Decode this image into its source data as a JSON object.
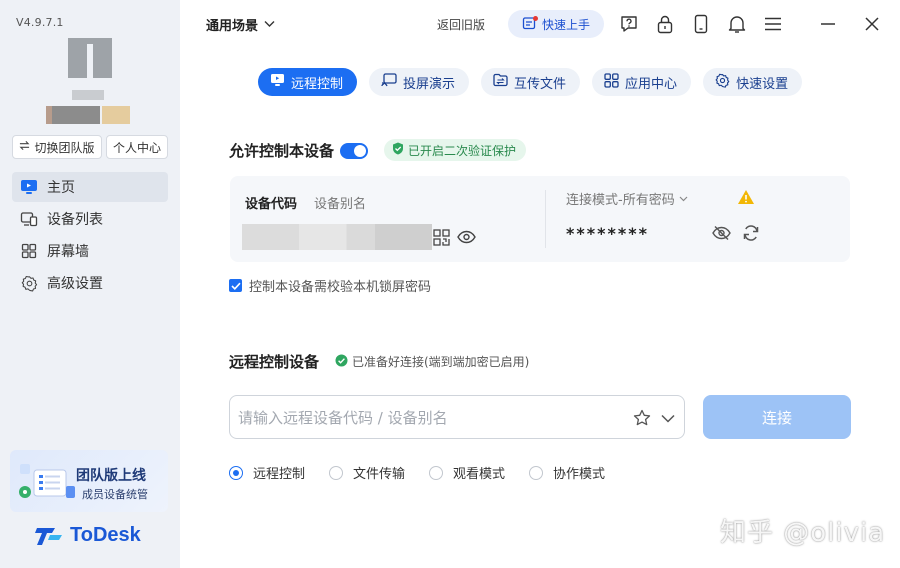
{
  "app": {
    "version": "V4.9.7.1",
    "brand_name": "ToDesk"
  },
  "sidebar": {
    "switch_team_label": "切换团队版",
    "personal_center_label": "个人中心",
    "items": [
      {
        "label": "主页",
        "icon": "monitor-icon",
        "active": true
      },
      {
        "label": "设备列表",
        "icon": "devices-icon",
        "active": false
      },
      {
        "label": "屏幕墙",
        "icon": "grid-icon",
        "active": false
      },
      {
        "label": "高级设置",
        "icon": "gear-icon",
        "active": false
      }
    ],
    "promo": {
      "title": "团队版上线",
      "subtitle": "成员设备统管"
    }
  },
  "topbar": {
    "scene_label": "通用场景",
    "back_old_label": "返回旧版",
    "quick_start_label": "快速上手",
    "icons": [
      "help-icon",
      "lock-icon",
      "phone-icon",
      "bell-icon",
      "menu-icon",
      "minimize-icon",
      "close-icon"
    ]
  },
  "tabs": [
    {
      "label": "远程控制",
      "icon": "remote-control-icon",
      "active": true
    },
    {
      "label": "投屏演示",
      "icon": "cast-icon",
      "active": false
    },
    {
      "label": "互传文件",
      "icon": "file-transfer-icon",
      "active": false
    },
    {
      "label": "应用中心",
      "icon": "app-center-icon",
      "active": false
    },
    {
      "label": "快速设置",
      "icon": "quick-settings-icon",
      "active": false
    }
  ],
  "allow_control": {
    "title": "允许控制本设备",
    "toggle_on": true,
    "protection_label": "已开启二次验证保护",
    "device_code_label": "设备代码",
    "device_alias_label": "设备别名",
    "connection_mode_label": "连接模式-所有密码",
    "password_masked": "********",
    "lock_check_label": "控制本设备需校验本机锁屏密码",
    "lock_check_checked": true
  },
  "remote_control": {
    "title": "远程控制设备",
    "ready_label": "已准备好连接(端到端加密已启用)",
    "input_placeholder": "请输入远程设备代码 / 设备别名",
    "input_value": "",
    "connect_label": "连接",
    "modes": [
      {
        "label": "远程控制",
        "selected": true
      },
      {
        "label": "文件传输",
        "selected": false
      },
      {
        "label": "观看模式",
        "selected": false
      },
      {
        "label": "协作模式",
        "selected": false
      }
    ]
  },
  "watermark": "知乎 @olivia",
  "colors": {
    "primary": "#1c6ef2",
    "sidebar_bg": "#eef1f6",
    "success": "#2a8a4e",
    "warning": "#f2b705",
    "connect_disabled": "#9dc3f6"
  }
}
